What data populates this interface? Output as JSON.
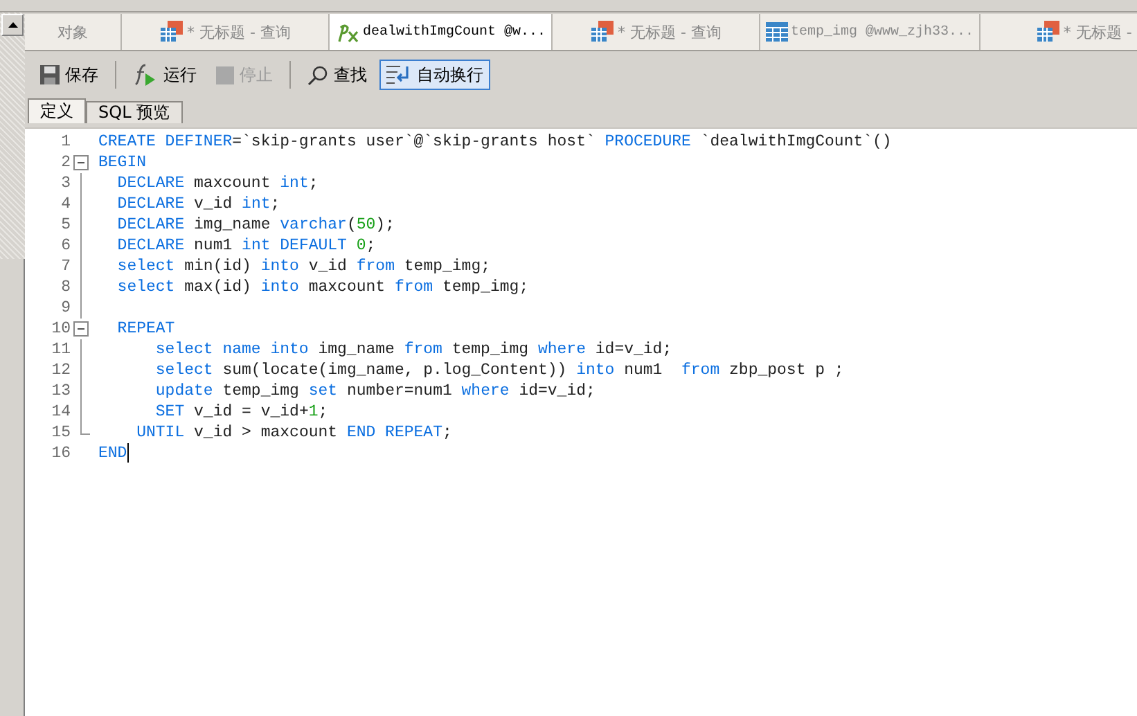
{
  "tabs": [
    {
      "label": "对象",
      "kind": "object",
      "selected": false
    },
    {
      "label": "* 无标题 - 查询",
      "kind": "query",
      "selected": false
    },
    {
      "label": "dealwithImgCount @w...",
      "kind": "function",
      "selected": true
    },
    {
      "label": "* 无标题 - 查询",
      "kind": "query",
      "selected": false
    },
    {
      "label": "temp_img @www_zjh33...",
      "kind": "table",
      "selected": false
    },
    {
      "label": "* 无标题 -",
      "kind": "query",
      "selected": false
    }
  ],
  "toolbar": [
    {
      "label": "保存",
      "kind": "save",
      "disabled": false,
      "selected": false
    },
    {
      "label": "运行",
      "kind": "run",
      "disabled": false,
      "selected": false
    },
    {
      "label": "停止",
      "kind": "stop",
      "disabled": true,
      "selected": false
    },
    {
      "label": "查找",
      "kind": "find",
      "disabled": false,
      "selected": false
    },
    {
      "label": "自动换行",
      "kind": "wrap",
      "disabled": false,
      "selected": true
    }
  ],
  "subtabs": [
    {
      "label": "定义",
      "selected": true
    },
    {
      "label": "SQL 预览",
      "selected": false
    }
  ],
  "editor": {
    "lines": [
      {
        "number": "1",
        "fold_start": false,
        "fold_end": false,
        "tokens": [
          {
            "text": "CREATE DEFINER",
            "kind": "kw"
          },
          {
            "text": "=`skip-grants user`@`skip-grants host` ",
            "kind": "plain"
          },
          {
            "text": "PROCEDURE",
            "kind": "kw"
          },
          {
            "text": " `dealwithImgCount`()",
            "kind": "plain"
          }
        ]
      },
      {
        "number": "2",
        "fold_start": true,
        "fold_end": false,
        "tokens": [
          {
            "text": "BEGIN",
            "kind": "kw"
          }
        ]
      },
      {
        "number": "3",
        "fold_start": false,
        "fold_end": false,
        "tokens": [
          {
            "text": "  DECLARE",
            "kind": "kw"
          },
          {
            "text": " maxcount ",
            "kind": "plain"
          },
          {
            "text": "int",
            "kind": "kw"
          },
          {
            "text": ";",
            "kind": "plain"
          }
        ]
      },
      {
        "number": "4",
        "fold_start": false,
        "fold_end": false,
        "tokens": [
          {
            "text": "  DECLARE",
            "kind": "kw"
          },
          {
            "text": " v_id ",
            "kind": "plain"
          },
          {
            "text": "int",
            "kind": "kw"
          },
          {
            "text": ";",
            "kind": "plain"
          }
        ]
      },
      {
        "number": "5",
        "fold_start": false,
        "fold_end": false,
        "tokens": [
          {
            "text": "  DECLARE",
            "kind": "kw"
          },
          {
            "text": " img_name ",
            "kind": "plain"
          },
          {
            "text": "varchar",
            "kind": "kw"
          },
          {
            "text": "(",
            "kind": "plain"
          },
          {
            "text": "50",
            "kind": "num"
          },
          {
            "text": ");",
            "kind": "plain"
          }
        ]
      },
      {
        "number": "6",
        "fold_start": false,
        "fold_end": false,
        "tokens": [
          {
            "text": "  DECLARE",
            "kind": "kw"
          },
          {
            "text": " num1 ",
            "kind": "plain"
          },
          {
            "text": "int DEFAULT ",
            "kind": "kw"
          },
          {
            "text": "0",
            "kind": "num"
          },
          {
            "text": ";",
            "kind": "plain"
          }
        ]
      },
      {
        "number": "7",
        "fold_start": false,
        "fold_end": false,
        "tokens": [
          {
            "text": "  select",
            "kind": "kw"
          },
          {
            "text": " min(id) ",
            "kind": "plain"
          },
          {
            "text": "into",
            "kind": "kw"
          },
          {
            "text": " v_id ",
            "kind": "plain"
          },
          {
            "text": "from",
            "kind": "kw"
          },
          {
            "text": " temp_img;",
            "kind": "plain"
          }
        ]
      },
      {
        "number": "8",
        "fold_start": false,
        "fold_end": false,
        "tokens": [
          {
            "text": "  select",
            "kind": "kw"
          },
          {
            "text": " max(id) ",
            "kind": "plain"
          },
          {
            "text": "into",
            "kind": "kw"
          },
          {
            "text": " maxcount ",
            "kind": "plain"
          },
          {
            "text": "from",
            "kind": "kw"
          },
          {
            "text": " temp_img;",
            "kind": "plain"
          }
        ]
      },
      {
        "number": "9",
        "fold_start": false,
        "fold_end": false
      },
      {
        "number": "10",
        "fold_start": true,
        "fold_end": false,
        "tokens": [
          {
            "text": "  REPEAT",
            "kind": "kw"
          }
        ]
      },
      {
        "number": "11",
        "fold_start": false,
        "fold_end": false,
        "tokens": [
          {
            "text": "      select name into",
            "kind": "kw"
          },
          {
            "text": " img_name ",
            "kind": "plain"
          },
          {
            "text": "from",
            "kind": "kw"
          },
          {
            "text": " temp_img ",
            "kind": "plain"
          },
          {
            "text": "where",
            "kind": "kw"
          },
          {
            "text": " id=v_id;",
            "kind": "plain"
          }
        ]
      },
      {
        "number": "12",
        "fold_start": false,
        "fold_end": false,
        "tokens": [
          {
            "text": "      select",
            "kind": "kw"
          },
          {
            "text": " sum(locate(img_name, p.log_Content)) ",
            "kind": "plain"
          },
          {
            "text": "into",
            "kind": "kw"
          },
          {
            "text": " num1  ",
            "kind": "plain"
          },
          {
            "text": "from",
            "kind": "kw"
          },
          {
            "text": " zbp_post p ;",
            "kind": "plain"
          }
        ]
      },
      {
        "number": "13",
        "fold_start": false,
        "fold_end": false,
        "tokens": [
          {
            "text": "      update",
            "kind": "kw"
          },
          {
            "text": " temp_img ",
            "kind": "plain"
          },
          {
            "text": "set",
            "kind": "kw"
          },
          {
            "text": " number=num1 ",
            "kind": "plain"
          },
          {
            "text": "where",
            "kind": "kw"
          },
          {
            "text": " id=v_id;",
            "kind": "plain"
          }
        ]
      },
      {
        "number": "14",
        "fold_start": false,
        "fold_end": false,
        "tokens": [
          {
            "text": "      SET",
            "kind": "kw"
          },
          {
            "text": " v_id = v_id+",
            "kind": "plain"
          },
          {
            "text": "1",
            "kind": "num"
          },
          {
            "text": ";",
            "kind": "plain"
          }
        ]
      },
      {
        "number": "15",
        "fold_start": false,
        "fold_end": true,
        "tokens": [
          {
            "text": "    UNTIL",
            "kind": "kw"
          },
          {
            "text": " v_id > maxcount ",
            "kind": "plain"
          },
          {
            "text": "END REPEAT",
            "kind": "kw"
          },
          {
            "text": ";",
            "kind": "plain"
          }
        ]
      },
      {
        "number": "16",
        "fold_start": false,
        "fold_end": false,
        "cursor": true,
        "tokens": [
          {
            "text": "END",
            "kind": "kw"
          }
        ]
      }
    ]
  }
}
